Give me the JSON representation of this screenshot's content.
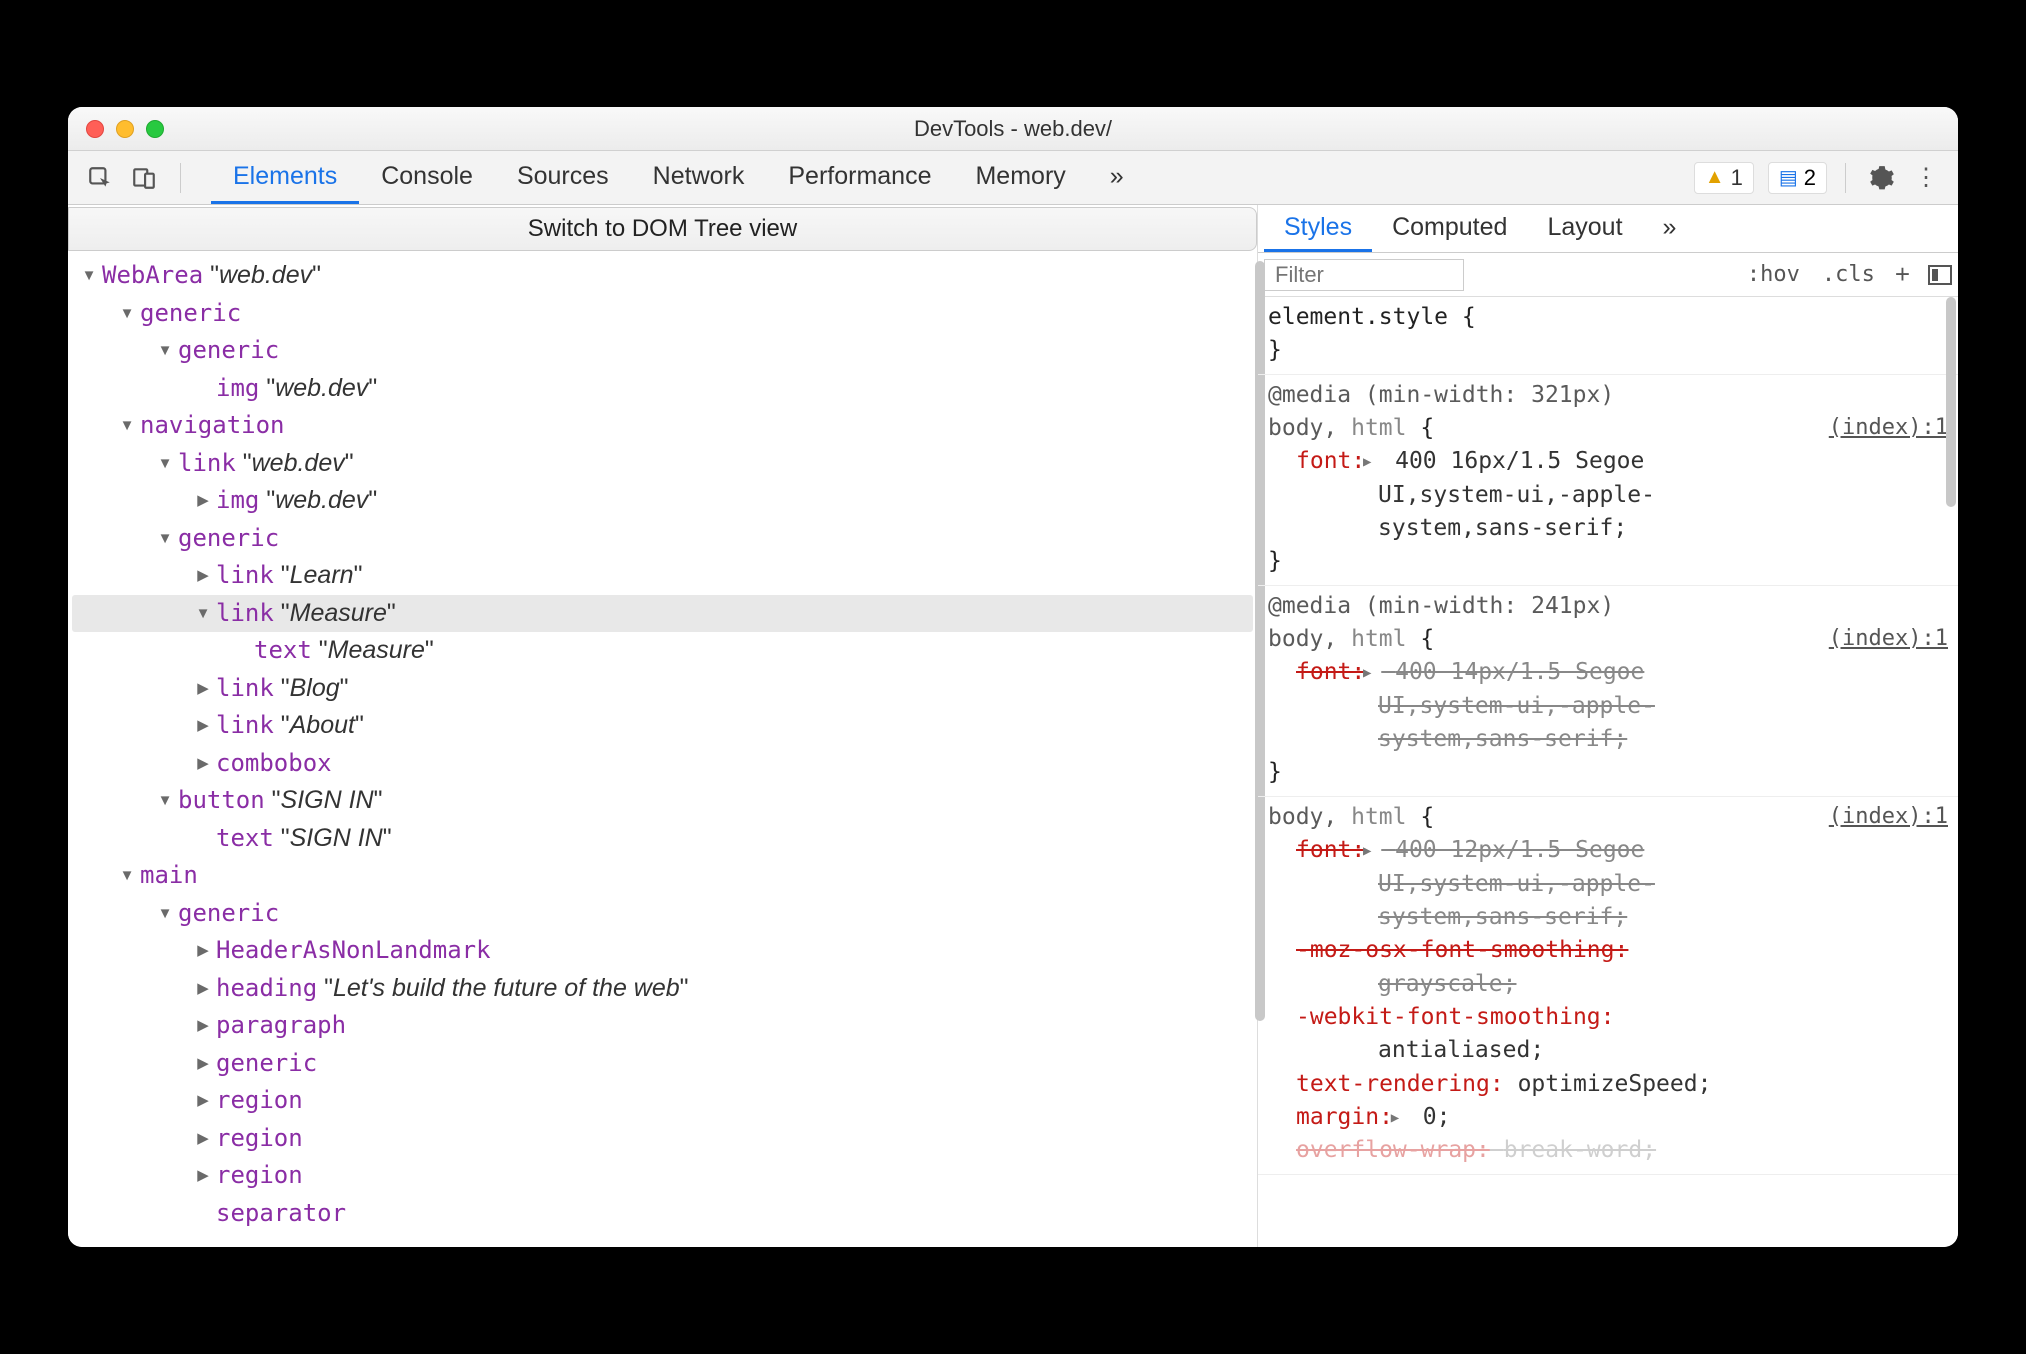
{
  "window": {
    "title": "DevTools - web.dev/"
  },
  "toolbar": {
    "tabs": [
      "Elements",
      "Console",
      "Sources",
      "Network",
      "Performance",
      "Memory"
    ],
    "active_tab": 0,
    "overflow": "»",
    "warnings": "1",
    "issues": "2"
  },
  "switch_label": "Switch to DOM Tree view",
  "tree": [
    {
      "ind": 0,
      "arrow": "down",
      "role": "WebArea",
      "name": "web.dev"
    },
    {
      "ind": 1,
      "arrow": "down",
      "role": "generic"
    },
    {
      "ind": 2,
      "arrow": "down",
      "role": "generic"
    },
    {
      "ind": 3,
      "arrow": "none",
      "role": "img",
      "name": "web.dev"
    },
    {
      "ind": 1,
      "arrow": "down",
      "role": "navigation"
    },
    {
      "ind": 2,
      "arrow": "down",
      "role": "link",
      "name": "web.dev"
    },
    {
      "ind": 3,
      "arrow": "right",
      "role": "img",
      "name": "web.dev"
    },
    {
      "ind": 2,
      "arrow": "down",
      "role": "generic"
    },
    {
      "ind": 3,
      "arrow": "right",
      "role": "link",
      "name": "Learn"
    },
    {
      "ind": 3,
      "arrow": "down",
      "role": "link",
      "name": "Measure",
      "sel": true
    },
    {
      "ind": 4,
      "arrow": "none",
      "role": "text",
      "name": "Measure"
    },
    {
      "ind": 3,
      "arrow": "right",
      "role": "link",
      "name": "Blog"
    },
    {
      "ind": 3,
      "arrow": "right",
      "role": "link",
      "name": "About"
    },
    {
      "ind": 3,
      "arrow": "right",
      "role": "combobox"
    },
    {
      "ind": 2,
      "arrow": "down",
      "role": "button",
      "name": "SIGN IN"
    },
    {
      "ind": 3,
      "arrow": "none",
      "role": "text",
      "name": "SIGN IN"
    },
    {
      "ind": 1,
      "arrow": "down",
      "role": "main"
    },
    {
      "ind": 2,
      "arrow": "down",
      "role": "generic"
    },
    {
      "ind": 3,
      "arrow": "right",
      "role": "HeaderAsNonLandmark"
    },
    {
      "ind": 3,
      "arrow": "right",
      "role": "heading",
      "name": "Let's build the future of the web"
    },
    {
      "ind": 3,
      "arrow": "right",
      "role": "paragraph"
    },
    {
      "ind": 3,
      "arrow": "right",
      "role": "generic"
    },
    {
      "ind": 3,
      "arrow": "right",
      "role": "region"
    },
    {
      "ind": 3,
      "arrow": "right",
      "role": "region"
    },
    {
      "ind": 3,
      "arrow": "right",
      "role": "region"
    },
    {
      "ind": 3,
      "arrow": "none",
      "role": "separator"
    }
  ],
  "styles": {
    "tabs": [
      "Styles",
      "Computed",
      "Layout"
    ],
    "overflow": "»",
    "filter_placeholder": "Filter",
    "hov": ":hov",
    "cls": ".cls",
    "element_style": "element.style {",
    "close_brace": "}",
    "source_link": "(index):1",
    "rule1": {
      "media": "@media (min-width: 321px)",
      "selector": "body, ",
      "selector2": "html",
      "open": " {",
      "prop": "font:",
      "val1": "400 16px/1.5 Segoe",
      "val2": "UI,system-ui,-apple-",
      "val3": "system,sans-serif;"
    },
    "rule2": {
      "media": "@media (min-width: 241px)",
      "selector": "body, ",
      "selector2": "html",
      "open": " {",
      "prop": "font:",
      "val1": "400 14px/1.5 Segoe",
      "val2": "UI,system-ui,-apple-",
      "val3": "system,sans-serif;"
    },
    "rule3": {
      "selector": "body, ",
      "selector2": "html",
      "open": " {",
      "p1": "font:",
      "v1a": "400 12px/1.5 Segoe",
      "v1b": "UI,system-ui,-apple-",
      "v1c": "system,sans-serif;",
      "p2": "-moz-osx-font-smoothing:",
      "v2": "grayscale;",
      "p3": "-webkit-font-smoothing:",
      "v3": "antialiased;",
      "p4": "text-rendering:",
      "v4": "optimizeSpeed;",
      "p5": "margin:",
      "v5": "0;",
      "p6": "overflow-wrap:",
      "v6": "break-word;"
    }
  }
}
